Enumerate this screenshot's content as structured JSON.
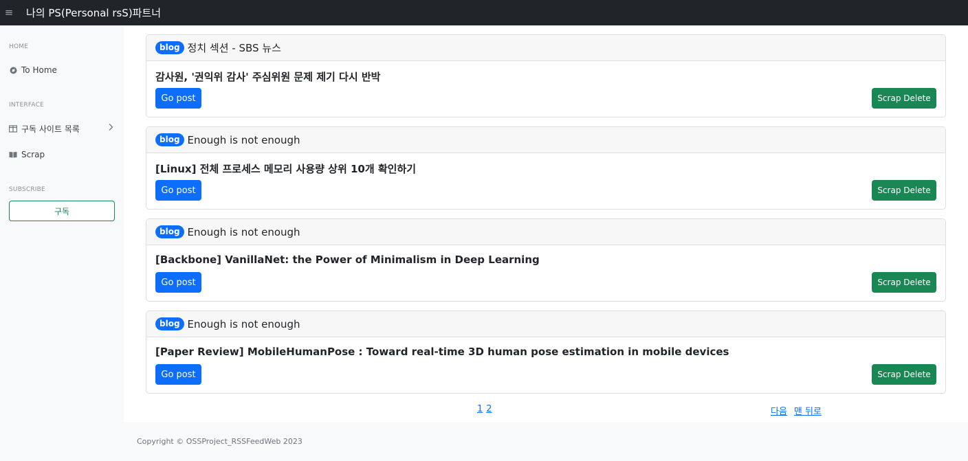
{
  "header": {
    "menu_icon": "hamburger-icon",
    "brand": "나의 PS(Personal rsS)파트너"
  },
  "sidebar": {
    "home_heading": "HOME",
    "home_link": {
      "label": "To Home",
      "icon": "home-circle-icon"
    },
    "interface_heading": "INTERFACE",
    "subscriptions_link": {
      "label": "구독 사이트 목록",
      "icon": "columns-icon",
      "chevron": "chevron-right-icon"
    },
    "scrap_link": {
      "label": "Scrap",
      "icon": "book-icon"
    },
    "subscribe_heading": "SUBSCRIBE",
    "subscribe_button": "구독"
  },
  "posts": [
    {
      "badge": "blog",
      "source": "정치 섹션 - SBS 뉴스",
      "title": "감사원, '권익위 감사' 주심위원 문제 제기 다시 반박",
      "go_label": "Go post",
      "scrap_label": "Scrap Delete"
    },
    {
      "badge": "blog",
      "source": "Enough is not enough",
      "title": "[Linux] 전체 프로세스 메모리 사용량 상위 10개 확인하기",
      "go_label": "Go post",
      "scrap_label": "Scrap Delete"
    },
    {
      "badge": "blog",
      "source": "Enough is not enough",
      "title": "[Backbone] VanillaNet: the Power of Minimalism in Deep Learning",
      "go_label": "Go post",
      "scrap_label": "Scrap Delete"
    },
    {
      "badge": "blog",
      "source": "Enough is not enough",
      "title": "[Paper Review] MobileHumanPose : Toward real-time 3D human pose estimation in mobile devices",
      "go_label": "Go post",
      "scrap_label": "Scrap Delete"
    }
  ],
  "pagination": {
    "pages": [
      "1",
      "2"
    ],
    "next": "다음",
    "last": "맨 뒤로"
  },
  "footer": {
    "copyright": "Copyright © OSSProject_RSSFeedWeb 2023"
  },
  "colors": {
    "topbar": "#212529",
    "primary": "#0d6efd",
    "success": "#198754"
  }
}
